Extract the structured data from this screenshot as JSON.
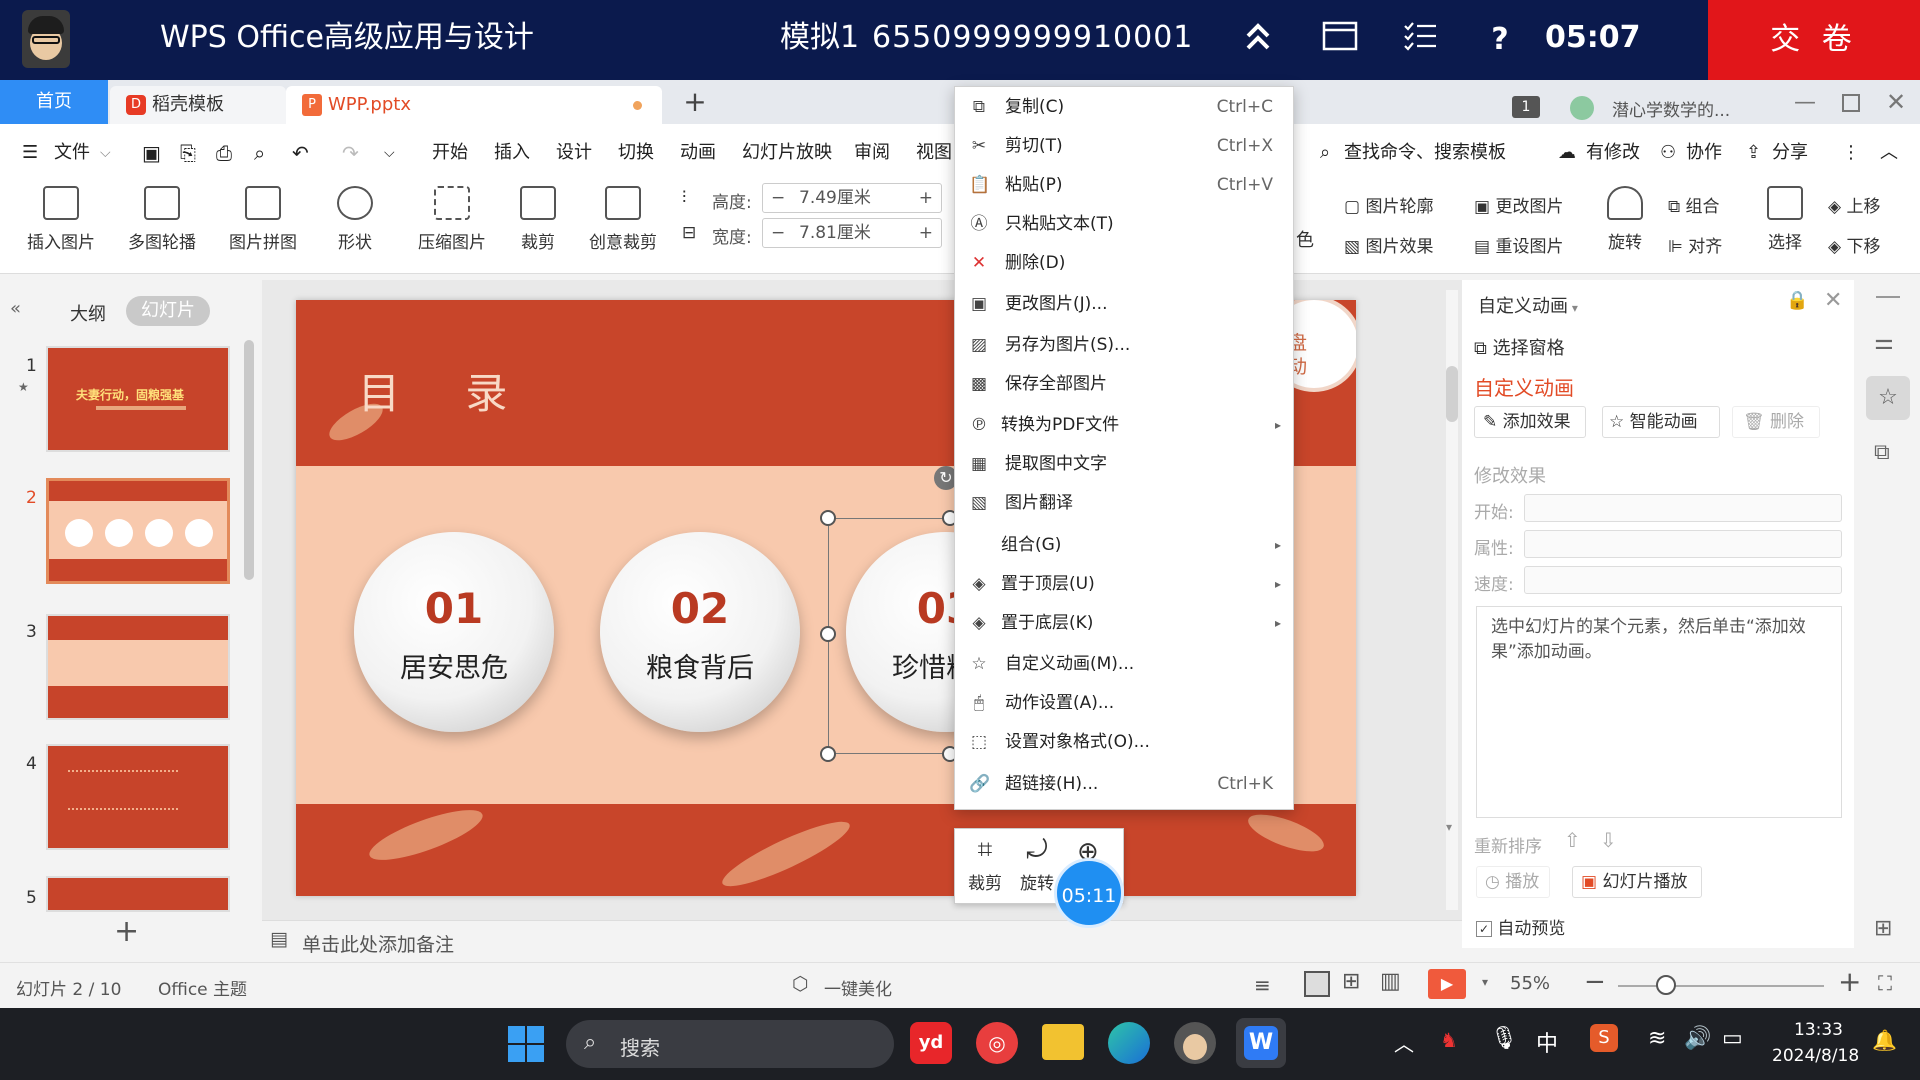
{
  "exam_bar": {
    "title": "WPS Office高级应用与设计",
    "exam_name": "模拟1",
    "exam_id": "6550999999910001",
    "clock": "05:07",
    "submit_label": "交 卷",
    "icons": [
      "double-chevron-up-icon",
      "window-icon",
      "checklist-icon",
      "help-icon"
    ]
  },
  "tabs": {
    "home": "首页",
    "docer": "稻壳模板",
    "file": "WPP.pptx",
    "badge": "1",
    "user_label": "潜心学数学的..."
  },
  "menu": {
    "file": "文件",
    "items": [
      "开始",
      "插入",
      "设计",
      "切换",
      "动画",
      "幻灯片放映",
      "审阅",
      "视图"
    ],
    "search_placeholder": "查找命令、搜索模板",
    "has_changes": "有修改",
    "collab": "协作",
    "share": "分享"
  },
  "ribbon": {
    "insert_picture": "插入图片",
    "multi_carousel": "多图轮播",
    "collage": "图片拼图",
    "shape": "形状",
    "compress": "压缩图片",
    "crop": "裁剪",
    "creative_crop": "创意裁剪",
    "height_label": "高度:",
    "height_value": "7.49厘米",
    "width_label": "宽度:",
    "width_value": "7.81厘米",
    "color_partial": "色",
    "outline": "图片轮廓",
    "effect": "图片效果",
    "change_pic": "更改图片",
    "reset_pic": "重设图片",
    "rotate": "旋转",
    "group": "组合",
    "align": "对齐",
    "select": "选择",
    "move_up": "上移",
    "move_down": "下移"
  },
  "left_panel": {
    "outline_tab": "大纲",
    "slides_tab": "幻灯片",
    "slide_numbers": [
      "1",
      "2",
      "3",
      "4",
      "5"
    ],
    "thumb1_title": "夫妻行动，固粮强基"
  },
  "slide": {
    "heading": "目 录",
    "badge_text_1": "盘",
    "badge_text_2": "动",
    "items": [
      {
        "num": "01",
        "text": "居安思危"
      },
      {
        "num": "02",
        "text": "粮食背后"
      },
      {
        "num": "03",
        "text": "珍惜粮食"
      }
    ]
  },
  "context_menu": {
    "items": [
      {
        "label": "复制(C)",
        "shortcut": "Ctrl+C",
        "icon": "copy-icon"
      },
      {
        "label": "剪切(T)",
        "shortcut": "Ctrl+X",
        "icon": "scissors-icon"
      },
      {
        "label": "粘贴(P)",
        "shortcut": "Ctrl+V",
        "icon": "paste-icon"
      },
      {
        "label": "只粘贴文本(T)",
        "shortcut": "",
        "icon": "paste-text-icon"
      },
      {
        "label": "删除(D)",
        "shortcut": "",
        "icon": "delete-x-icon"
      },
      {
        "label": "更改图片(J)...",
        "shortcut": "",
        "icon": "change-picture-icon"
      },
      {
        "label": "另存为图片(S)...",
        "shortcut": "",
        "icon": "save-picture-icon"
      },
      {
        "label": "保存全部图片",
        "shortcut": "",
        "icon": "save-all-pictures-icon"
      },
      {
        "label": "转换为PDF文件",
        "shortcut": "",
        "icon": "pdf-icon"
      },
      {
        "label": "提取图中文字",
        "shortcut": "",
        "icon": "ocr-icon"
      },
      {
        "label": "图片翻译",
        "shortcut": "",
        "icon": "translate-icon"
      },
      {
        "label": "组合(G)",
        "shortcut": "",
        "icon": ""
      },
      {
        "label": "置于顶层(U)",
        "shortcut": "",
        "icon": "bring-front-icon"
      },
      {
        "label": "置于底层(K)",
        "shortcut": "",
        "icon": "send-back-icon"
      },
      {
        "label": "自定义动画(M)...",
        "shortcut": "",
        "icon": "animation-star-icon"
      },
      {
        "label": "动作设置(A)...",
        "shortcut": "",
        "icon": "mouse-icon"
      },
      {
        "label": "设置对象格式(O)...",
        "shortcut": "",
        "icon": "format-icon"
      },
      {
        "label": "超链接(H)...",
        "shortcut": "Ctrl+K",
        "icon": "link-icon"
      }
    ]
  },
  "mini_toolbar": {
    "crop": "裁剪",
    "rotate": "旋转",
    "timer": "05:11"
  },
  "right_pane": {
    "header": "自定义动画",
    "selection_pane": "选择窗格",
    "section_title": "自定义动画",
    "add_effect": "添加效果",
    "smart_anim": "智能动画",
    "delete": "删除",
    "modify_effect": "修改效果",
    "start_label": "开始:",
    "property_label": "属性:",
    "speed_label": "速度:",
    "hint": "选中幻灯片的某个元素，然后单击“添加效果”添加动画。",
    "reorder": "重新排序",
    "play": "播放",
    "slideshow": "幻灯片播放",
    "auto_preview": "自动预览"
  },
  "notes_placeholder": "单击此处添加备注",
  "status": {
    "slide_info": "幻灯片 2 / 10",
    "theme": "Office 主题",
    "beautify": "一键美化",
    "zoom": "55%"
  },
  "taskbar": {
    "search": "搜索",
    "ime": "中",
    "time": "13:33",
    "date": "2024/8/18"
  },
  "colors": {
    "exam_bar": "#0b1a4d",
    "submit": "#e1161a",
    "slide_red": "#c8452a",
    "slide_peach": "#f8c9ad",
    "accent_blue": "#2f8df5",
    "accent_orange": "#e24b26"
  }
}
